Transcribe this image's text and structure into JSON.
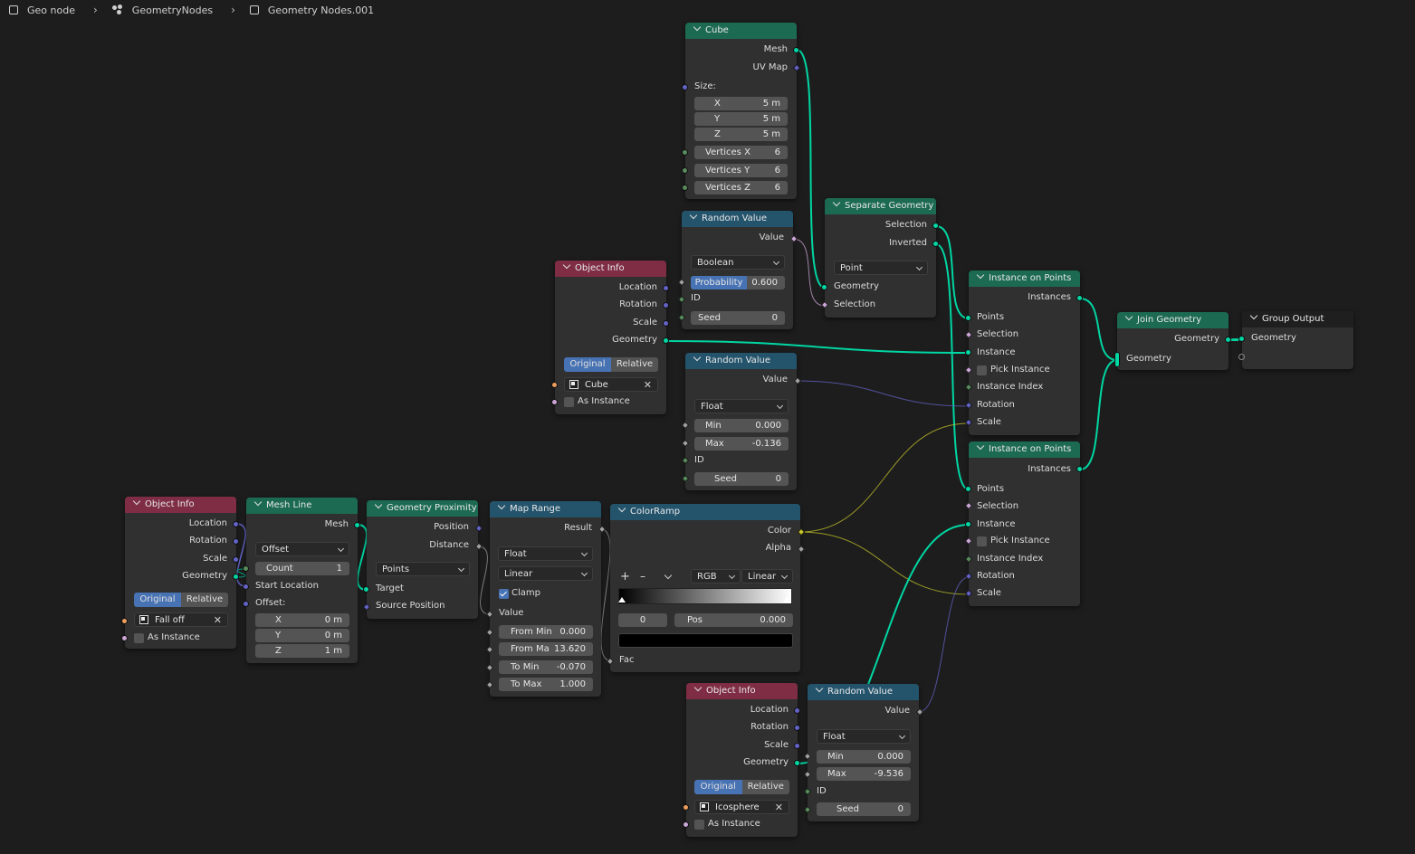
{
  "breadcrumb": {
    "object": "Geo node",
    "modifier": "GeometryNodes",
    "tree": "Geometry Nodes.001"
  },
  "colors": {
    "geometry": "#00d6a3",
    "vector": "#6363c7",
    "integer": "#598c5c",
    "float": "#a1a1a1",
    "boolean": "#cca6d6",
    "object": "#ed9e5c",
    "color": "#c7c729"
  },
  "cube": {
    "title": "Cube",
    "out_mesh": "Mesh",
    "out_uv": "UV Map",
    "size_label": "Size:",
    "x_label": "X",
    "x_val": "5 m",
    "y_label": "Y",
    "y_val": "5 m",
    "z_label": "Z",
    "z_val": "5 m",
    "vx_label": "Vertices X",
    "vx_val": "6",
    "vy_label": "Vertices Y",
    "vy_val": "6",
    "vz_label": "Vertices Z",
    "vz_val": "6"
  },
  "rv1": {
    "title": "Random Value",
    "out": "Value",
    "type": "Boolean",
    "prob_label": "Probability",
    "prob_val": "0.600",
    "id": "ID",
    "seed_label": "Seed",
    "seed_val": "0"
  },
  "sep": {
    "title": "Separate Geometry",
    "out_sel": "Selection",
    "out_inv": "Inverted",
    "domain": "Point",
    "in_geo": "Geometry",
    "in_sel": "Selection"
  },
  "oi1": {
    "title": "Object Info",
    "loc": "Location",
    "rot": "Rotation",
    "scale": "Scale",
    "geo": "Geometry",
    "original": "Original",
    "relative": "Relative",
    "object": "Cube",
    "as_instance": "As Instance"
  },
  "rv2": {
    "title": "Random Value",
    "out": "Value",
    "type": "Float",
    "min_label": "Min",
    "min_val": "0.000",
    "max_label": "Max",
    "max_val": "-0.136",
    "id": "ID",
    "seed_label": "Seed",
    "seed_val": "0"
  },
  "iop1": {
    "title": "Instance on Points",
    "out": "Instances",
    "points": "Points",
    "selection": "Selection",
    "instance": "Instance",
    "pick": "Pick Instance",
    "index": "Instance Index",
    "rotation": "Rotation",
    "scale": "Scale"
  },
  "iop2": {
    "title": "Instance on Points",
    "out": "Instances",
    "points": "Points",
    "selection": "Selection",
    "instance": "Instance",
    "pick": "Pick Instance",
    "index": "Instance Index",
    "rotation": "Rotation",
    "scale": "Scale"
  },
  "join": {
    "title": "Join Geometry",
    "out": "Geometry",
    "in": "Geometry"
  },
  "gout": {
    "title": "Group Output",
    "in": "Geometry"
  },
  "oi2": {
    "title": "Object Info",
    "loc": "Location",
    "rot": "Rotation",
    "scale": "Scale",
    "geo": "Geometry",
    "original": "Original",
    "relative": "Relative",
    "object": "Fall off",
    "as_instance": "As Instance"
  },
  "ml": {
    "title": "Mesh Line",
    "out": "Mesh",
    "mode": "Offset",
    "count_label": "Count",
    "count_val": "1",
    "start": "Start Location",
    "offset": "Offset:",
    "x_label": "X",
    "x_val": "0 m",
    "y_label": "Y",
    "y_val": "0 m",
    "z_label": "Z",
    "z_val": "1 m"
  },
  "gp": {
    "title": "Geometry Proximity",
    "pos": "Position",
    "dist": "Distance",
    "mode": "Points",
    "target": "Target",
    "src": "Source Position"
  },
  "mr": {
    "title": "Map Range",
    "out": "Result",
    "type": "Float",
    "interp": "Linear",
    "clamp": "Clamp",
    "value": "Value",
    "fmin_label": "From Min",
    "fmin_val": "0.000",
    "fmax_label": "From Ma",
    "fmax_val": "13.620",
    "tmin_label": "To Min",
    "tmin_val": "-0.070",
    "tmax_label": "To Max",
    "tmax_val": "1.000"
  },
  "cr": {
    "title": "ColorRamp",
    "color": "Color",
    "alpha": "Alpha",
    "plus": "+",
    "minus": "–",
    "mode": "RGB",
    "interp": "Linear",
    "index": "0",
    "pos_label": "Pos",
    "pos_val": "0.000",
    "fac": "Fac"
  },
  "oi3": {
    "title": "Object Info",
    "loc": "Location",
    "rot": "Rotation",
    "scale": "Scale",
    "geo": "Geometry",
    "original": "Original",
    "relative": "Relative",
    "object": "Icosphere",
    "as_instance": "As Instance"
  },
  "rv3": {
    "title": "Random Value",
    "out": "Value",
    "type": "Float",
    "min_label": "Min",
    "min_val": "0.000",
    "max_label": "Max",
    "max_val": "-9.536",
    "id": "ID",
    "seed_label": "Seed",
    "seed_val": "0"
  }
}
